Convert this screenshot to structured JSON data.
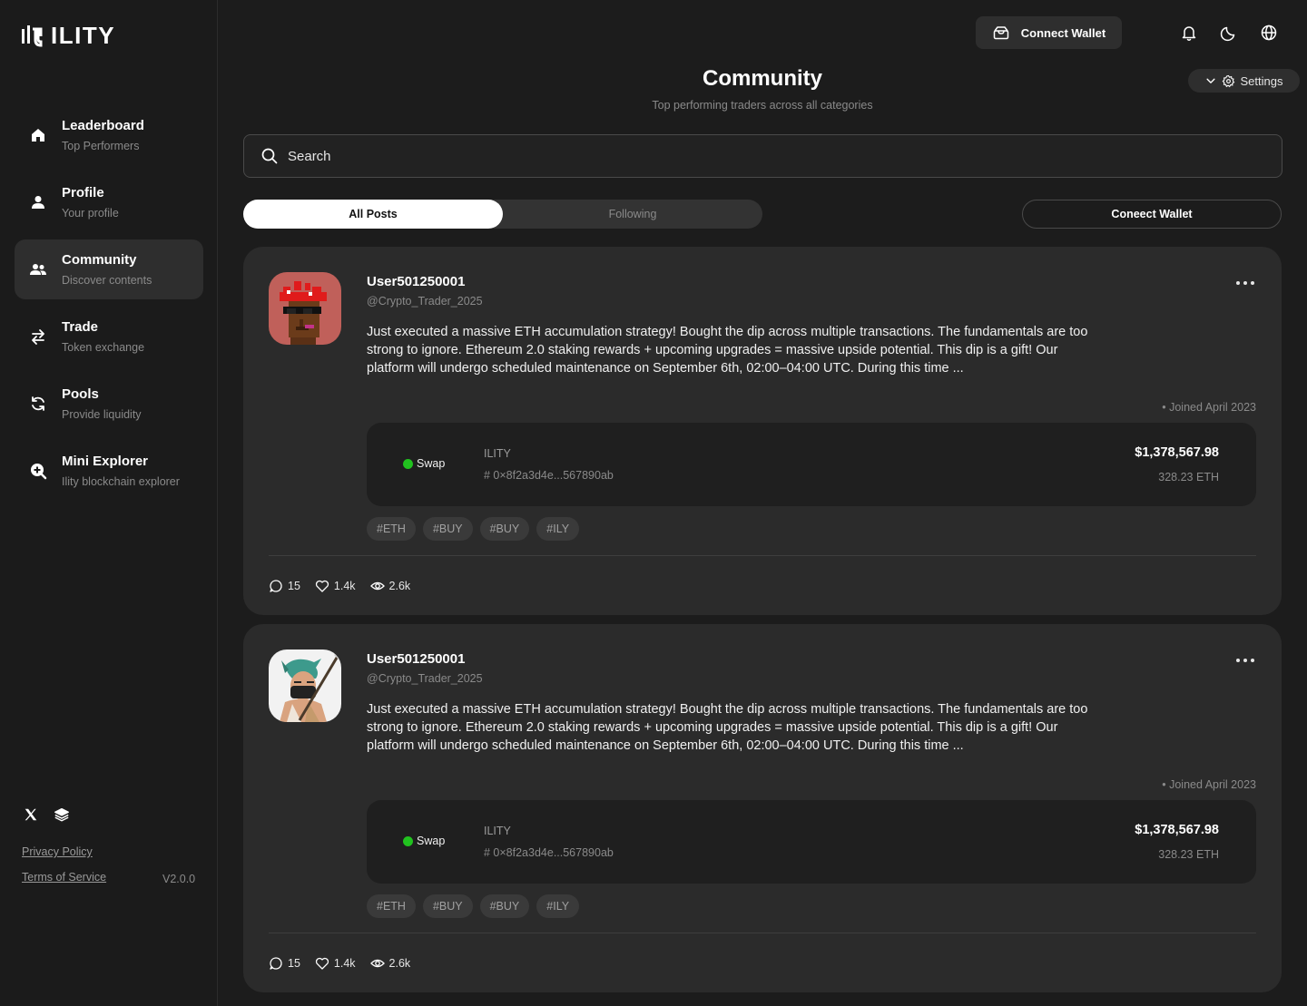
{
  "app": {
    "logo_text": "ILITY"
  },
  "sidebar": {
    "items": [
      {
        "title": "Leaderboard",
        "subtitle": "Top Performers",
        "icon": "home-icon"
      },
      {
        "title": "Profile",
        "subtitle": "Your profile",
        "icon": "user-icon"
      },
      {
        "title": "Community",
        "subtitle": "Discover contents",
        "icon": "users-icon",
        "active": true
      },
      {
        "title": "Trade",
        "subtitle": "Token exchange",
        "icon": "swap-arrows-icon"
      },
      {
        "title": "Pools",
        "subtitle": "Provide liquidity",
        "icon": "refresh-icon"
      },
      {
        "title": "Mini Explorer",
        "subtitle": "Ility blockchain explorer",
        "icon": "search-plus-icon"
      }
    ],
    "privacy": "Privacy Policy",
    "terms": "Terms of Service",
    "version": "V2.0.0"
  },
  "topbar": {
    "connect_wallet": "Connect Wallet",
    "settings": "Settings"
  },
  "header": {
    "title": "Community",
    "subtitle": "Top performing traders across all categories"
  },
  "search": {
    "placeholder": "Search"
  },
  "tabs": [
    {
      "label": "All Posts",
      "active": true
    },
    {
      "label": "Following",
      "active": false
    }
  ],
  "connect_wallet_2": "Coneect Wallet",
  "posts": [
    {
      "username": "User501250001",
      "handle": "@Crypto_Trader_2025",
      "text": "Just executed a massive ETH accumulation strategy! Bought the dip across multiple transactions. The fundamentals are too strong to ignore. Ethereum 2.0 staking rewards + upcoming upgrades = massive upside potential. This dip is a gift! Our platform will undergo scheduled maintenance on September 6th, 02:00–04:00 UTC. During this time ...",
      "joined": "• Joined April 2023",
      "tx": {
        "type": "Swap",
        "token": "ILITY",
        "hash": "# 0×8f2a3d4e...567890ab",
        "amount": "$1,378,567.98",
        "eth": "328.23 ETH"
      },
      "tags": [
        "#ETH",
        "#BUY",
        "#BUY",
        "#ILY"
      ],
      "comments": "15",
      "likes": "1.4k",
      "views": "2.6k"
    },
    {
      "username": "User501250001",
      "handle": "@Crypto_Trader_2025",
      "text": "Just executed a massive ETH accumulation strategy! Bought the dip across multiple transactions. The fundamentals are too strong to ignore. Ethereum 2.0 staking rewards + upcoming upgrades = massive upside potential. This dip is a gift! Our platform will undergo scheduled maintenance on September 6th, 02:00–04:00 UTC. During this time ...",
      "joined": "• Joined April 2023",
      "tx": {
        "type": "Swap",
        "token": "ILITY",
        "hash": "# 0×8f2a3d4e...567890ab",
        "amount": "$1,378,567.98",
        "eth": "328.23 ETH"
      },
      "tags": [
        "#ETH",
        "#BUY",
        "#BUY",
        "#ILY"
      ],
      "comments": "15",
      "likes": "1.4k",
      "views": "2.6k"
    }
  ],
  "colors": {
    "background": "#1c1c1c",
    "card": "#2b2b2b",
    "accent_green": "#21c21f"
  }
}
